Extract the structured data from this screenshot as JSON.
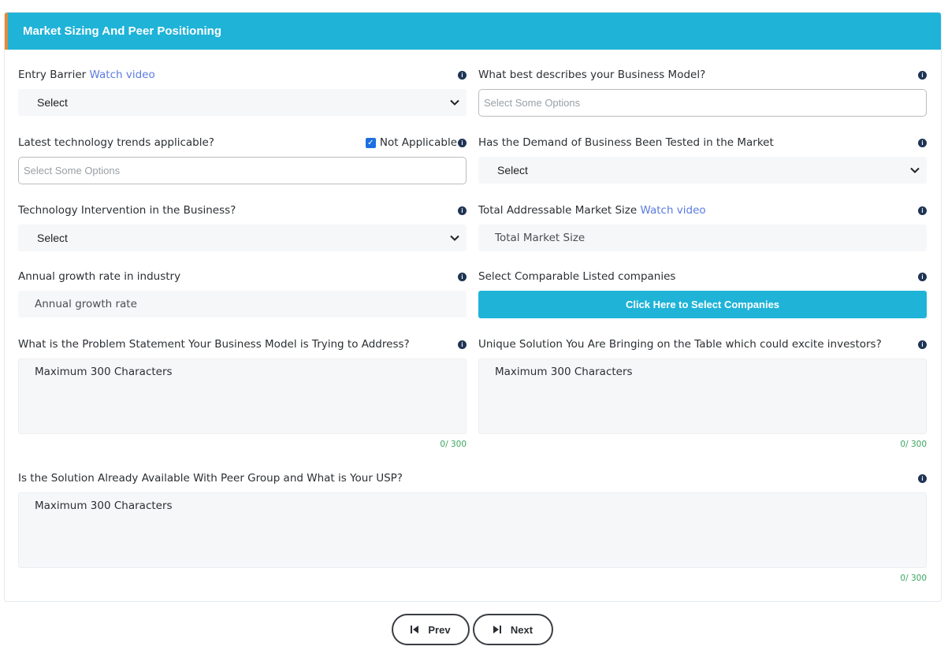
{
  "header": {
    "title": "Market Sizing And Peer Positioning"
  },
  "fields": {
    "entry_barrier": {
      "label": "Entry Barrier",
      "link": "Watch video",
      "value": "Select"
    },
    "business_model": {
      "label": "What best describes your Business Model?",
      "placeholder": "Select Some Options"
    },
    "tech_trends": {
      "label": "Latest technology trends applicable?",
      "not_applicable": "Not Applicable",
      "placeholder": "Select Some Options"
    },
    "demand_tested": {
      "label": "Has the Demand of Business Been Tested in the Market",
      "value": "Select"
    },
    "tech_intervention": {
      "label": "Technology Intervention in the Business?",
      "value": "Select"
    },
    "tam": {
      "label": "Total Addressable Market Size",
      "link": "Watch video",
      "placeholder": "Total Market Size"
    },
    "growth_rate": {
      "label": "Annual growth rate in industry",
      "placeholder": "Annual growth rate"
    },
    "comparables": {
      "label": "Select Comparable Listed companies",
      "button": "Click Here to Select Companies"
    },
    "problem": {
      "label": "What is the Problem Statement Your Business Model is Trying to Address?",
      "placeholder": "Maximum 300 Characters",
      "count": "0",
      "max": "/ 300"
    },
    "solution": {
      "label": "Unique Solution You Are Bringing on the Table which could excite investors?",
      "placeholder": "Maximum 300 Characters",
      "count": "0",
      "max": "/ 300"
    },
    "usp": {
      "label": "Is the Solution Already Available With Peer Group and What is Your USP?",
      "placeholder": "Maximum 300 Characters",
      "count": "0",
      "max": "/ 300"
    }
  },
  "info_icon": "info-icon",
  "nav": {
    "prev": "Prev",
    "next": "Next"
  },
  "colors": {
    "accent": "#1fb3d8",
    "header_stripe": "#e28a3c",
    "link": "#5b7be0",
    "counter": "#3aa55d",
    "info_icon": "#1f3454",
    "checkbox": "#1d6fe0"
  }
}
